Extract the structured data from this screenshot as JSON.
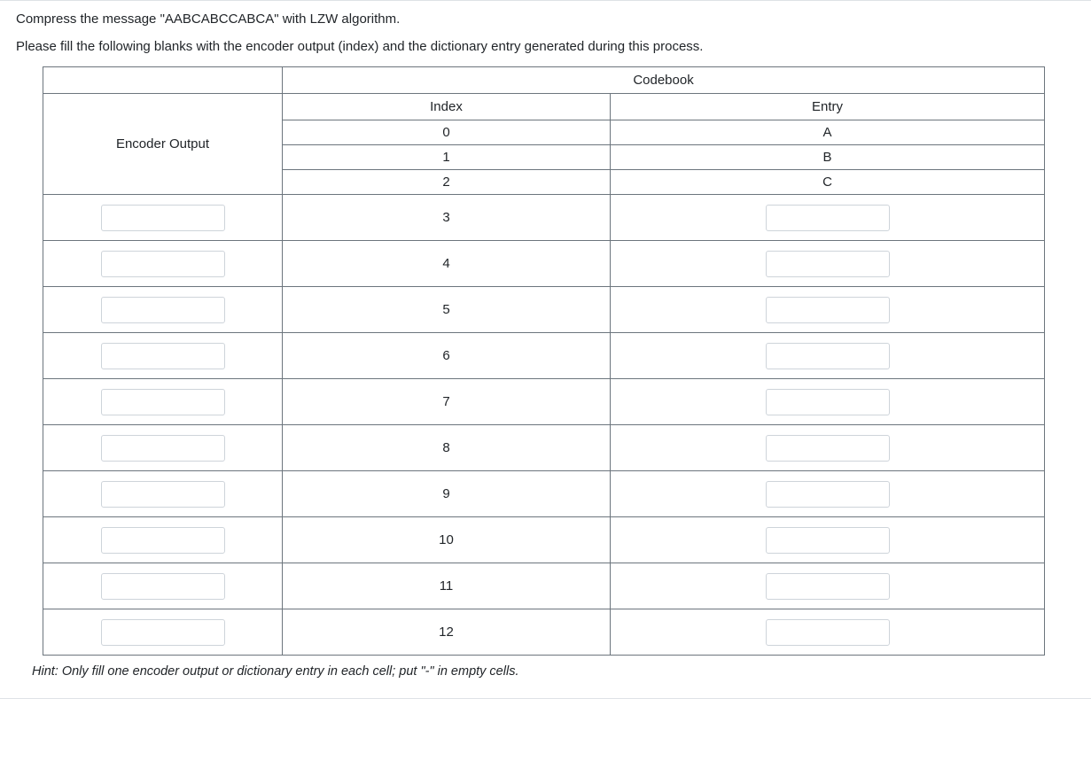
{
  "question": {
    "line1": "Compress the message \"AABCABCCABCA\" with LZW algorithm.",
    "line2": "Please fill the following blanks with the encoder output (index) and the dictionary entry generated during this process."
  },
  "table": {
    "codebook_header": "Codebook",
    "encoder_output_header": "Encoder Output",
    "index_header": "Index",
    "entry_header": "Entry",
    "fixed_rows": [
      {
        "index": "0",
        "entry": "A"
      },
      {
        "index": "1",
        "entry": "B"
      },
      {
        "index": "2",
        "entry": "C"
      }
    ],
    "input_rows": [
      {
        "index": "3"
      },
      {
        "index": "4"
      },
      {
        "index": "5"
      },
      {
        "index": "6"
      },
      {
        "index": "7"
      },
      {
        "index": "8"
      },
      {
        "index": "9"
      },
      {
        "index": "10"
      },
      {
        "index": "11"
      },
      {
        "index": "12"
      }
    ]
  },
  "hint": "Hint: Only fill one encoder output or dictionary entry in each cell; put \"-\" in empty cells."
}
